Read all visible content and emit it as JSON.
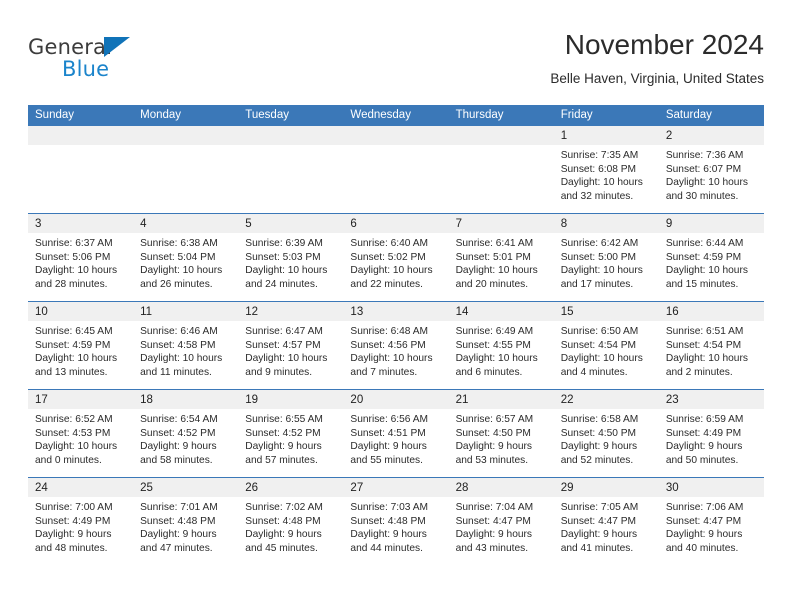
{
  "brand": {
    "name_top": "General",
    "name_bottom": "Blue",
    "triangle_color": "#1073b8",
    "blue_text_color": "#1b84cb"
  },
  "header": {
    "title": "November 2024",
    "subtitle": "Belle Haven, Virginia, United States"
  },
  "theme": {
    "header_row_bg": "#3b78b8",
    "day_band_bg": "#f0f0f0",
    "divider": "#3b78b8",
    "text": "#2b2b2b"
  },
  "weekdays": [
    "Sunday",
    "Monday",
    "Tuesday",
    "Wednesday",
    "Thursday",
    "Friday",
    "Saturday"
  ],
  "weeks": [
    [
      {
        "date": "",
        "sunrise": "",
        "sunset": "",
        "daylight1": "",
        "daylight2": "",
        "empty": true
      },
      {
        "date": "",
        "sunrise": "",
        "sunset": "",
        "daylight1": "",
        "daylight2": "",
        "empty": true
      },
      {
        "date": "",
        "sunrise": "",
        "sunset": "",
        "daylight1": "",
        "daylight2": "",
        "empty": true
      },
      {
        "date": "",
        "sunrise": "",
        "sunset": "",
        "daylight1": "",
        "daylight2": "",
        "empty": true
      },
      {
        "date": "",
        "sunrise": "",
        "sunset": "",
        "daylight1": "",
        "daylight2": "",
        "empty": true
      },
      {
        "date": "1",
        "sunrise": "Sunrise: 7:35 AM",
        "sunset": "Sunset: 6:08 PM",
        "daylight1": "Daylight: 10 hours",
        "daylight2": "and 32 minutes."
      },
      {
        "date": "2",
        "sunrise": "Sunrise: 7:36 AM",
        "sunset": "Sunset: 6:07 PM",
        "daylight1": "Daylight: 10 hours",
        "daylight2": "and 30 minutes."
      }
    ],
    [
      {
        "date": "3",
        "sunrise": "Sunrise: 6:37 AM",
        "sunset": "Sunset: 5:06 PM",
        "daylight1": "Daylight: 10 hours",
        "daylight2": "and 28 minutes."
      },
      {
        "date": "4",
        "sunrise": "Sunrise: 6:38 AM",
        "sunset": "Sunset: 5:04 PM",
        "daylight1": "Daylight: 10 hours",
        "daylight2": "and 26 minutes."
      },
      {
        "date": "5",
        "sunrise": "Sunrise: 6:39 AM",
        "sunset": "Sunset: 5:03 PM",
        "daylight1": "Daylight: 10 hours",
        "daylight2": "and 24 minutes."
      },
      {
        "date": "6",
        "sunrise": "Sunrise: 6:40 AM",
        "sunset": "Sunset: 5:02 PM",
        "daylight1": "Daylight: 10 hours",
        "daylight2": "and 22 minutes."
      },
      {
        "date": "7",
        "sunrise": "Sunrise: 6:41 AM",
        "sunset": "Sunset: 5:01 PM",
        "daylight1": "Daylight: 10 hours",
        "daylight2": "and 20 minutes."
      },
      {
        "date": "8",
        "sunrise": "Sunrise: 6:42 AM",
        "sunset": "Sunset: 5:00 PM",
        "daylight1": "Daylight: 10 hours",
        "daylight2": "and 17 minutes."
      },
      {
        "date": "9",
        "sunrise": "Sunrise: 6:44 AM",
        "sunset": "Sunset: 4:59 PM",
        "daylight1": "Daylight: 10 hours",
        "daylight2": "and 15 minutes."
      }
    ],
    [
      {
        "date": "10",
        "sunrise": "Sunrise: 6:45 AM",
        "sunset": "Sunset: 4:59 PM",
        "daylight1": "Daylight: 10 hours",
        "daylight2": "and 13 minutes."
      },
      {
        "date": "11",
        "sunrise": "Sunrise: 6:46 AM",
        "sunset": "Sunset: 4:58 PM",
        "daylight1": "Daylight: 10 hours",
        "daylight2": "and 11 minutes."
      },
      {
        "date": "12",
        "sunrise": "Sunrise: 6:47 AM",
        "sunset": "Sunset: 4:57 PM",
        "daylight1": "Daylight: 10 hours",
        "daylight2": "and 9 minutes."
      },
      {
        "date": "13",
        "sunrise": "Sunrise: 6:48 AM",
        "sunset": "Sunset: 4:56 PM",
        "daylight1": "Daylight: 10 hours",
        "daylight2": "and 7 minutes."
      },
      {
        "date": "14",
        "sunrise": "Sunrise: 6:49 AM",
        "sunset": "Sunset: 4:55 PM",
        "daylight1": "Daylight: 10 hours",
        "daylight2": "and 6 minutes."
      },
      {
        "date": "15",
        "sunrise": "Sunrise: 6:50 AM",
        "sunset": "Sunset: 4:54 PM",
        "daylight1": "Daylight: 10 hours",
        "daylight2": "and 4 minutes."
      },
      {
        "date": "16",
        "sunrise": "Sunrise: 6:51 AM",
        "sunset": "Sunset: 4:54 PM",
        "daylight1": "Daylight: 10 hours",
        "daylight2": "and 2 minutes."
      }
    ],
    [
      {
        "date": "17",
        "sunrise": "Sunrise: 6:52 AM",
        "sunset": "Sunset: 4:53 PM",
        "daylight1": "Daylight: 10 hours",
        "daylight2": "and 0 minutes."
      },
      {
        "date": "18",
        "sunrise": "Sunrise: 6:54 AM",
        "sunset": "Sunset: 4:52 PM",
        "daylight1": "Daylight: 9 hours",
        "daylight2": "and 58 minutes."
      },
      {
        "date": "19",
        "sunrise": "Sunrise: 6:55 AM",
        "sunset": "Sunset: 4:52 PM",
        "daylight1": "Daylight: 9 hours",
        "daylight2": "and 57 minutes."
      },
      {
        "date": "20",
        "sunrise": "Sunrise: 6:56 AM",
        "sunset": "Sunset: 4:51 PM",
        "daylight1": "Daylight: 9 hours",
        "daylight2": "and 55 minutes."
      },
      {
        "date": "21",
        "sunrise": "Sunrise: 6:57 AM",
        "sunset": "Sunset: 4:50 PM",
        "daylight1": "Daylight: 9 hours",
        "daylight2": "and 53 minutes."
      },
      {
        "date": "22",
        "sunrise": "Sunrise: 6:58 AM",
        "sunset": "Sunset: 4:50 PM",
        "daylight1": "Daylight: 9 hours",
        "daylight2": "and 52 minutes."
      },
      {
        "date": "23",
        "sunrise": "Sunrise: 6:59 AM",
        "sunset": "Sunset: 4:49 PM",
        "daylight1": "Daylight: 9 hours",
        "daylight2": "and 50 minutes."
      }
    ],
    [
      {
        "date": "24",
        "sunrise": "Sunrise: 7:00 AM",
        "sunset": "Sunset: 4:49 PM",
        "daylight1": "Daylight: 9 hours",
        "daylight2": "and 48 minutes."
      },
      {
        "date": "25",
        "sunrise": "Sunrise: 7:01 AM",
        "sunset": "Sunset: 4:48 PM",
        "daylight1": "Daylight: 9 hours",
        "daylight2": "and 47 minutes."
      },
      {
        "date": "26",
        "sunrise": "Sunrise: 7:02 AM",
        "sunset": "Sunset: 4:48 PM",
        "daylight1": "Daylight: 9 hours",
        "daylight2": "and 45 minutes."
      },
      {
        "date": "27",
        "sunrise": "Sunrise: 7:03 AM",
        "sunset": "Sunset: 4:48 PM",
        "daylight1": "Daylight: 9 hours",
        "daylight2": "and 44 minutes."
      },
      {
        "date": "28",
        "sunrise": "Sunrise: 7:04 AM",
        "sunset": "Sunset: 4:47 PM",
        "daylight1": "Daylight: 9 hours",
        "daylight2": "and 43 minutes."
      },
      {
        "date": "29",
        "sunrise": "Sunrise: 7:05 AM",
        "sunset": "Sunset: 4:47 PM",
        "daylight1": "Daylight: 9 hours",
        "daylight2": "and 41 minutes."
      },
      {
        "date": "30",
        "sunrise": "Sunrise: 7:06 AM",
        "sunset": "Sunset: 4:47 PM",
        "daylight1": "Daylight: 9 hours",
        "daylight2": "and 40 minutes."
      }
    ]
  ]
}
